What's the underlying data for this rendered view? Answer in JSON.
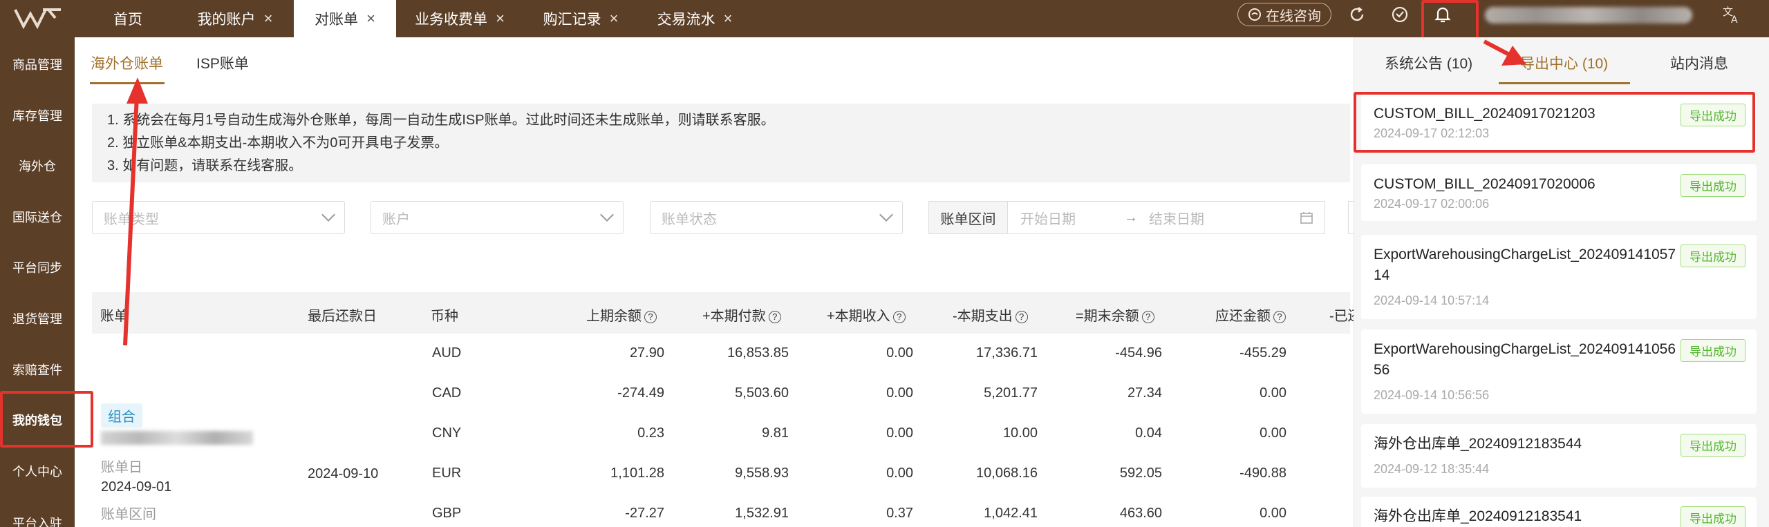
{
  "topbar": {
    "tabs": [
      {
        "label": "首页",
        "closable": false
      },
      {
        "label": "我的账户",
        "closable": true
      },
      {
        "label": "对账单",
        "closable": true,
        "active": true
      },
      {
        "label": "业务收费单",
        "closable": true
      },
      {
        "label": "购汇记录",
        "closable": true
      },
      {
        "label": "交易流水",
        "closable": true
      }
    ],
    "close_glyph": "×",
    "consult_label": "在线咨询",
    "icons": [
      "refresh-icon",
      "heart-icon",
      "bell-icon",
      "translate-icon"
    ]
  },
  "sidebar": {
    "items": [
      "商品管理",
      "库存管理",
      "海外仓",
      "国际送仓",
      "平台同步",
      "退货管理",
      "索赔查件",
      "我的钱包",
      "个人中心",
      "平台入驻"
    ],
    "active_index": 7
  },
  "subtabs": [
    "海外仓账单",
    "ISP账单"
  ],
  "notice": [
    "1. 系统会在每月1号自动生成海外仓账单，每周一自动生成ISP账单。过此时间还未生成账单，则请联系客服。",
    "2. 独立账单&本期支出-本期收入不为0可开具电子发票。",
    "3. 如有问题，请联系在线客服。"
  ],
  "filters": {
    "bill_type_placeholder": "账单类型",
    "account_placeholder": "账户",
    "status_placeholder": "账单状态",
    "date_label": "账单区间",
    "start_placeholder": "开始日期",
    "arrow": "→",
    "end_placeholder": "结束日期"
  },
  "table": {
    "headers": [
      "账单",
      "最后还款日",
      "币种",
      "上期余额",
      "+本期付款",
      "+本期收入",
      "-本期支出",
      "=期末余额",
      "应还金额",
      "-已还"
    ],
    "help_glyph": "?",
    "bill": {
      "tag": "组合",
      "date_label": "账单日",
      "date": "2024-09-01",
      "range_label": "账单区间",
      "due_date": "2024-09-10"
    },
    "rows": [
      {
        "currency": "AUD",
        "prev": "27.90",
        "paid": "16,853.85",
        "income": "0.00",
        "spend": "17,336.71",
        "end": "-454.96",
        "due": "-455.29"
      },
      {
        "currency": "CAD",
        "prev": "-274.49",
        "paid": "5,503.60",
        "income": "0.00",
        "spend": "5,201.77",
        "end": "27.34",
        "due": "0.00"
      },
      {
        "currency": "CNY",
        "prev": "0.23",
        "paid": "9.81",
        "income": "0.00",
        "spend": "10.00",
        "end": "0.04",
        "due": "0.00"
      },
      {
        "currency": "EUR",
        "prev": "1,101.28",
        "paid": "9,558.93",
        "income": "0.00",
        "spend": "10,068.16",
        "end": "592.05",
        "due": "-490.88"
      },
      {
        "currency": "GBP",
        "prev": "-27.27",
        "paid": "1,532.91",
        "income": "0.37",
        "spend": "1,042.41",
        "end": "463.60",
        "due": "0.00"
      }
    ]
  },
  "panel": {
    "tabs": [
      "系统公告 (10)",
      "导出中心 (10)",
      "站内消息"
    ],
    "active_tab": 1,
    "exports": [
      {
        "name": "CUSTOM_BILL_20240917021203",
        "time": "2024-09-17 02:12:03",
        "status": "导出成功"
      },
      {
        "name": "CUSTOM_BILL_20240917020006",
        "time": "2024-09-17 02:00:06",
        "status": "导出成功"
      },
      {
        "name": "ExportWarehousingChargeList_20240914105714",
        "time": "2024-09-14 10:57:14",
        "status": "导出成功"
      },
      {
        "name": "ExportWarehousingChargeList_20240914105656",
        "time": "2024-09-14 10:56:56",
        "status": "导出成功"
      },
      {
        "name": "海外仓出库单_20240912183544",
        "time": "2024-09-12 18:35:44",
        "status": "导出成功"
      },
      {
        "name": "海外仓出库单_20240912183541",
        "time": "",
        "status": "导出成功"
      }
    ]
  },
  "colors": {
    "brand": "#5c3f27",
    "accent": "#a0702c",
    "highlight": "#e5322d",
    "success": "#52b52f"
  }
}
